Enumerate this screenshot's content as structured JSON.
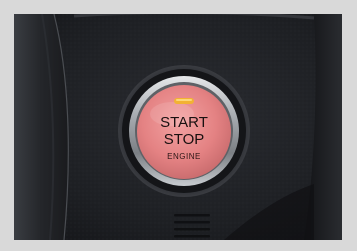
{
  "photo": {
    "button": {
      "line1": "START",
      "line2": "STOP",
      "line3": "ENGINE"
    },
    "colors": {
      "dashboard": "#1f2125",
      "button_face": "#e8878a",
      "chrome_ring": "#b9bdc2",
      "indicator": "#f2b233",
      "backdrop": "#d9d9d9"
    }
  }
}
